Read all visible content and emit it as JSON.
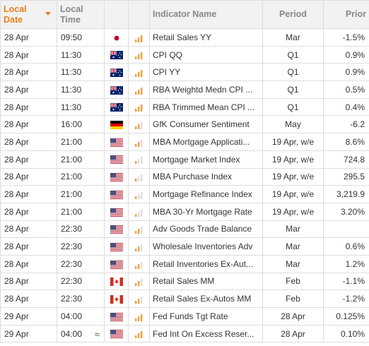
{
  "header": {
    "local_date": "Local Date",
    "local_time": "Local Time",
    "indicator_name": "Indicator Name",
    "period": "Period",
    "prior": "Prior"
  },
  "colors": {
    "accent": "#e8801e",
    "header_bg": "#f2f2f2",
    "importance_active": "#f0a040",
    "importance_inactive": "#dddddd"
  },
  "rows": [
    {
      "date": "28 Apr",
      "time": "09:50",
      "country": "JP",
      "flag": "japan-flag",
      "importance": 3,
      "name": "Retail Sales YY",
      "period": "Mar",
      "prior": "-1.5%",
      "approx": ""
    },
    {
      "date": "28 Apr",
      "time": "11:30",
      "country": "AU",
      "flag": "australia-flag",
      "importance": 3,
      "name": "CPI QQ",
      "period": "Q1",
      "prior": "0.9%",
      "approx": ""
    },
    {
      "date": "28 Apr",
      "time": "11:30",
      "country": "AU",
      "flag": "australia-flag",
      "importance": 3,
      "name": "CPI YY",
      "period": "Q1",
      "prior": "0.9%",
      "approx": ""
    },
    {
      "date": "28 Apr",
      "time": "11:30",
      "country": "AU",
      "flag": "australia-flag",
      "importance": 3,
      "name": "RBA Weightd Medn CPI ...",
      "period": "Q1",
      "prior": "0.5%",
      "approx": ""
    },
    {
      "date": "28 Apr",
      "time": "11:30",
      "country": "AU",
      "flag": "australia-flag",
      "importance": 3,
      "name": "RBA Trimmed Mean CPI ...",
      "period": "Q1",
      "prior": "0.4%",
      "approx": ""
    },
    {
      "date": "28 Apr",
      "time": "16:00",
      "country": "DE",
      "flag": "germany-flag",
      "importance": 2,
      "name": "GfK Consumer Sentiment",
      "period": "May",
      "prior": "-6.2",
      "approx": ""
    },
    {
      "date": "28 Apr",
      "time": "21:00",
      "country": "US",
      "flag": "usa-flag",
      "importance": 2,
      "name": "MBA Mortgage Applicati...",
      "period": "19 Apr, w/e",
      "prior": "8.6%",
      "approx": ""
    },
    {
      "date": "28 Apr",
      "time": "21:00",
      "country": "US",
      "flag": "usa-flag",
      "importance": 1,
      "name": "Mortgage Market Index",
      "period": "19 Apr, w/e",
      "prior": "724.8",
      "approx": ""
    },
    {
      "date": "28 Apr",
      "time": "21:00",
      "country": "US",
      "flag": "usa-flag",
      "importance": 1,
      "name": "MBA Purchase Index",
      "period": "19 Apr, w/e",
      "prior": "295.5",
      "approx": ""
    },
    {
      "date": "28 Apr",
      "time": "21:00",
      "country": "US",
      "flag": "usa-flag",
      "importance": 1,
      "name": "Mortgage Refinance Index",
      "period": "19 Apr, w/e",
      "prior": "3,219.9",
      "approx": ""
    },
    {
      "date": "28 Apr",
      "time": "21:00",
      "country": "US",
      "flag": "usa-flag",
      "importance": 1,
      "name": "MBA 30-Yr Mortgage Rate",
      "period": "19 Apr, w/e",
      "prior": "3.20%",
      "approx": ""
    },
    {
      "date": "28 Apr",
      "time": "22:30",
      "country": "US",
      "flag": "usa-flag",
      "importance": 2,
      "name": "Adv Goods Trade Balance",
      "period": "Mar",
      "prior": "",
      "approx": ""
    },
    {
      "date": "28 Apr",
      "time": "22:30",
      "country": "US",
      "flag": "usa-flag",
      "importance": 2,
      "name": "Wholesale Inventories Adv",
      "period": "Mar",
      "prior": "0.6%",
      "approx": ""
    },
    {
      "date": "28 Apr",
      "time": "22:30",
      "country": "US",
      "flag": "usa-flag",
      "importance": 2,
      "name": "Retail Inventories Ex-Aut...",
      "period": "Mar",
      "prior": "1.2%",
      "approx": ""
    },
    {
      "date": "28 Apr",
      "time": "22:30",
      "country": "CA",
      "flag": "canada-flag",
      "importance": 2,
      "name": "Retail Sales MM",
      "period": "Feb",
      "prior": "-1.1%",
      "approx": ""
    },
    {
      "date": "28 Apr",
      "time": "22:30",
      "country": "CA",
      "flag": "canada-flag",
      "importance": 2,
      "name": "Retail Sales Ex-Autos MM",
      "period": "Feb",
      "prior": "-1.2%",
      "approx": ""
    },
    {
      "date": "29 Apr",
      "time": "04:00",
      "country": "US",
      "flag": "usa-flag",
      "importance": 3,
      "name": "Fed Funds Tgt Rate",
      "period": "28 Apr",
      "prior": "0.125%",
      "approx": ""
    },
    {
      "date": "29 Apr",
      "time": "04:00",
      "country": "US",
      "flag": "usa-flag",
      "importance": 3,
      "name": "Fed Int On Excess Reser...",
      "period": "28 Apr",
      "prior": "0.10%",
      "approx": "≈"
    }
  ]
}
